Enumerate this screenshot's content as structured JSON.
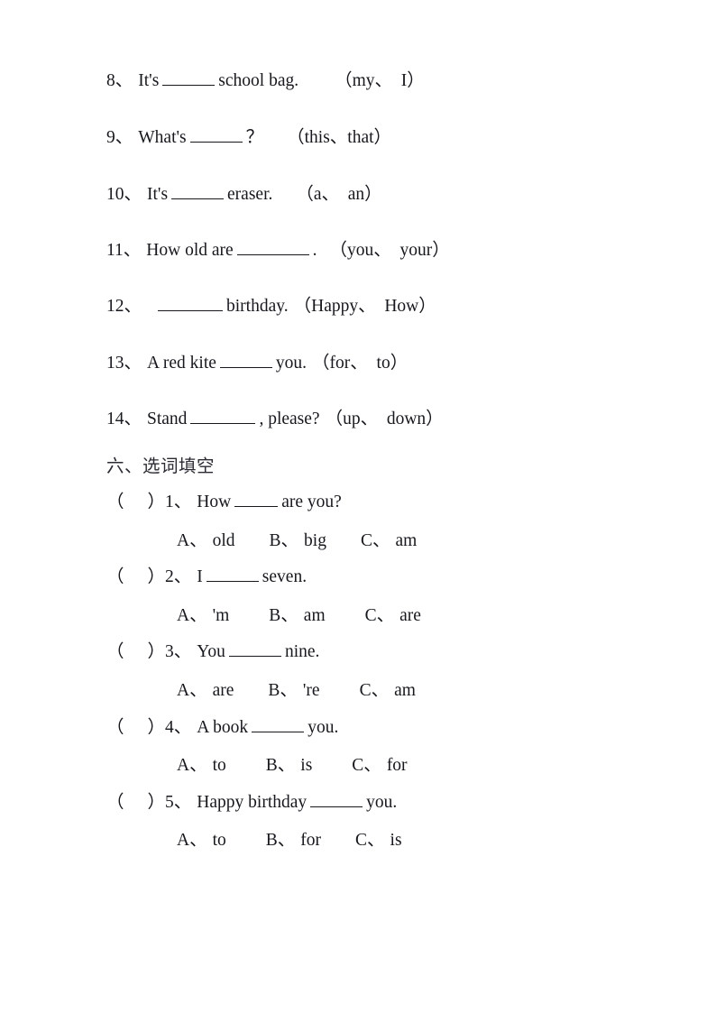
{
  "document": {
    "type": "english-worksheet-page",
    "background_color": "#ffffff",
    "text_color": "#16181d"
  },
  "fill_in_section": {
    "items": [
      {
        "number": "8、",
        "before": "It's",
        "blank_width": "mid",
        "after": "school bag.",
        "choices": "（my、　I）"
      },
      {
        "number": "9、",
        "before": "What's",
        "blank_width": "mid",
        "after": "？",
        "choices": "（this、that）"
      },
      {
        "number": "10、",
        "before": "It's",
        "blank_width": "mid",
        "after": "eraser.",
        "choices": "（a、　an）"
      },
      {
        "number": "11、",
        "before": "How old are",
        "blank_width": "xlong",
        "after": ".",
        "choices": "（you、　your）"
      },
      {
        "number": "12、",
        "before": "",
        "blank_width": "long",
        "after": "birthday.",
        "choices": "（Happy、　How）"
      },
      {
        "number": "13、",
        "before": "A   red   kite",
        "blank_width": "mid",
        "after": "you.",
        "choices": "（for、　to）"
      },
      {
        "number": "14、",
        "before": "Stand",
        "blank_width": "long",
        "after": ", please?",
        "choices": "（up、　down）"
      }
    ]
  },
  "choice_section": {
    "heading": "六、选词填空",
    "bracket_open": "（",
    "bracket_close": "）",
    "questions": [
      {
        "number": "1、",
        "before": "How",
        "blank_width": "short",
        "after": "are you?",
        "options": [
          {
            "letter": "A、",
            "text": "old"
          },
          {
            "letter": "B、",
            "text": "big"
          },
          {
            "letter": "C、",
            "text": "am"
          }
        ]
      },
      {
        "number": "2、",
        "before": "I",
        "blank_width": "mid",
        "after": "seven.",
        "options": [
          {
            "letter": "A、",
            "text": "'m"
          },
          {
            "letter": "B、",
            "text": "am"
          },
          {
            "letter": "C、",
            "text": "are"
          }
        ]
      },
      {
        "number": "3、",
        "before": "You",
        "blank_width": "mid",
        "after": "nine.",
        "options": [
          {
            "letter": "A、",
            "text": "are"
          },
          {
            "letter": "B、",
            "text": "'re"
          },
          {
            "letter": "C、",
            "text": "am"
          }
        ]
      },
      {
        "number": "4、",
        "before": "A book",
        "blank_width": "mid",
        "after": "you.",
        "options": [
          {
            "letter": "A、",
            "text": "to"
          },
          {
            "letter": "B、",
            "text": "is"
          },
          {
            "letter": "C、",
            "text": "for"
          }
        ]
      },
      {
        "number": "5、",
        "before": "Happy birthday",
        "blank_width": "mid",
        "after": "you.",
        "options": [
          {
            "letter": "A、",
            "text": "to"
          },
          {
            "letter": "B、",
            "text": "for"
          },
          {
            "letter": "C、",
            "text": "is"
          }
        ]
      }
    ]
  }
}
